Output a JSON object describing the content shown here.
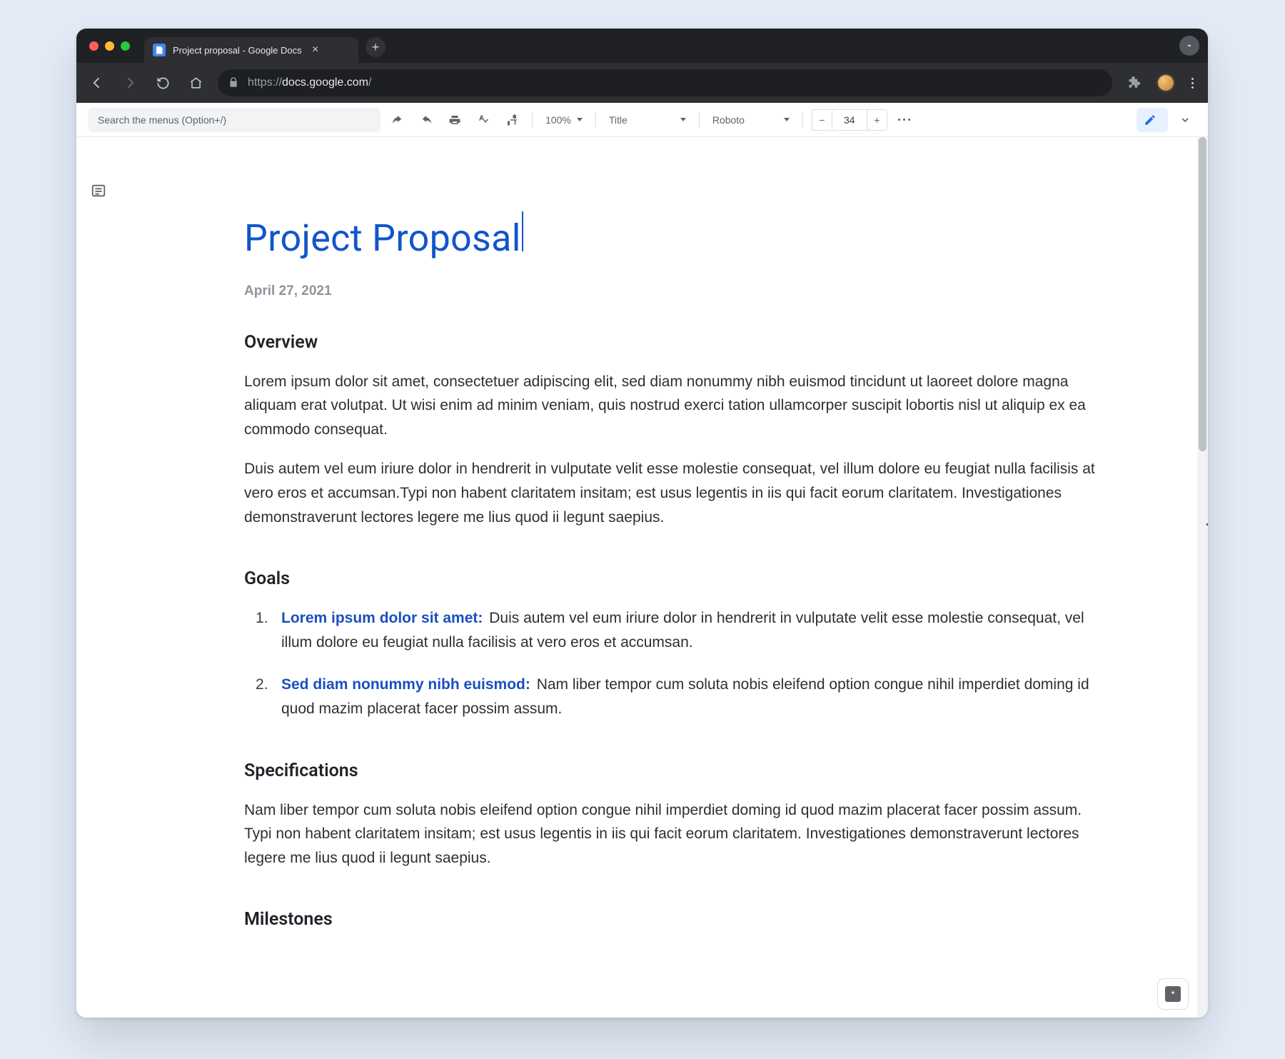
{
  "browser": {
    "tab_title": "Project proposal - Google Docs",
    "url_protocol": "https://",
    "url_host": "docs.google.com",
    "url_path": "/"
  },
  "toolbar": {
    "search_placeholder": "Search the menus (Option+/)",
    "zoom": "100%",
    "style": "Title",
    "font": "Roboto",
    "font_size": "34",
    "minus": "−",
    "plus": "+"
  },
  "doc": {
    "title": "Project Proposal",
    "date": "April 27, 2021",
    "sections": {
      "overview": {
        "heading": "Overview",
        "p1": "Lorem ipsum dolor sit amet, consectetuer adipiscing elit, sed diam nonummy nibh euismod tincidunt ut laoreet dolore magna aliquam erat volutpat. Ut wisi enim ad minim veniam, quis nostrud exerci tation ullamcorper suscipit lobortis nisl ut aliquip ex ea commodo consequat.",
        "p2": "Duis autem vel eum iriure dolor in hendrerit in vulputate velit esse molestie consequat, vel illum dolore eu feugiat nulla facilisis at vero eros et accumsan.Typi non habent claritatem insitam; est usus legentis in iis qui facit eorum claritatem. Investigationes demonstraverunt lectores legere me lius quod ii legunt saepius."
      },
      "goals": {
        "heading": "Goals",
        "items": [
          {
            "lead": "Lorem ipsum dolor sit amet:",
            "text": "Duis autem vel eum iriure dolor in hendrerit in vulputate velit esse molestie consequat, vel illum dolore eu feugiat nulla facilisis at vero eros et accumsan."
          },
          {
            "lead": "Sed diam nonummy nibh euismod:",
            "text": "Nam liber tempor cum soluta nobis eleifend option congue nihil imperdiet doming id quod mazim placerat facer possim assum."
          }
        ]
      },
      "specifications": {
        "heading": "Specifications",
        "p1": "Nam liber tempor cum soluta nobis eleifend option congue nihil imperdiet doming id quod mazim placerat facer possim assum. Typi non habent claritatem insitam; est usus legentis in iis qui facit eorum claritatem. Investigationes demonstraverunt lectores legere me lius quod ii legunt saepius."
      },
      "milestones": {
        "heading": "Milestones"
      }
    }
  }
}
